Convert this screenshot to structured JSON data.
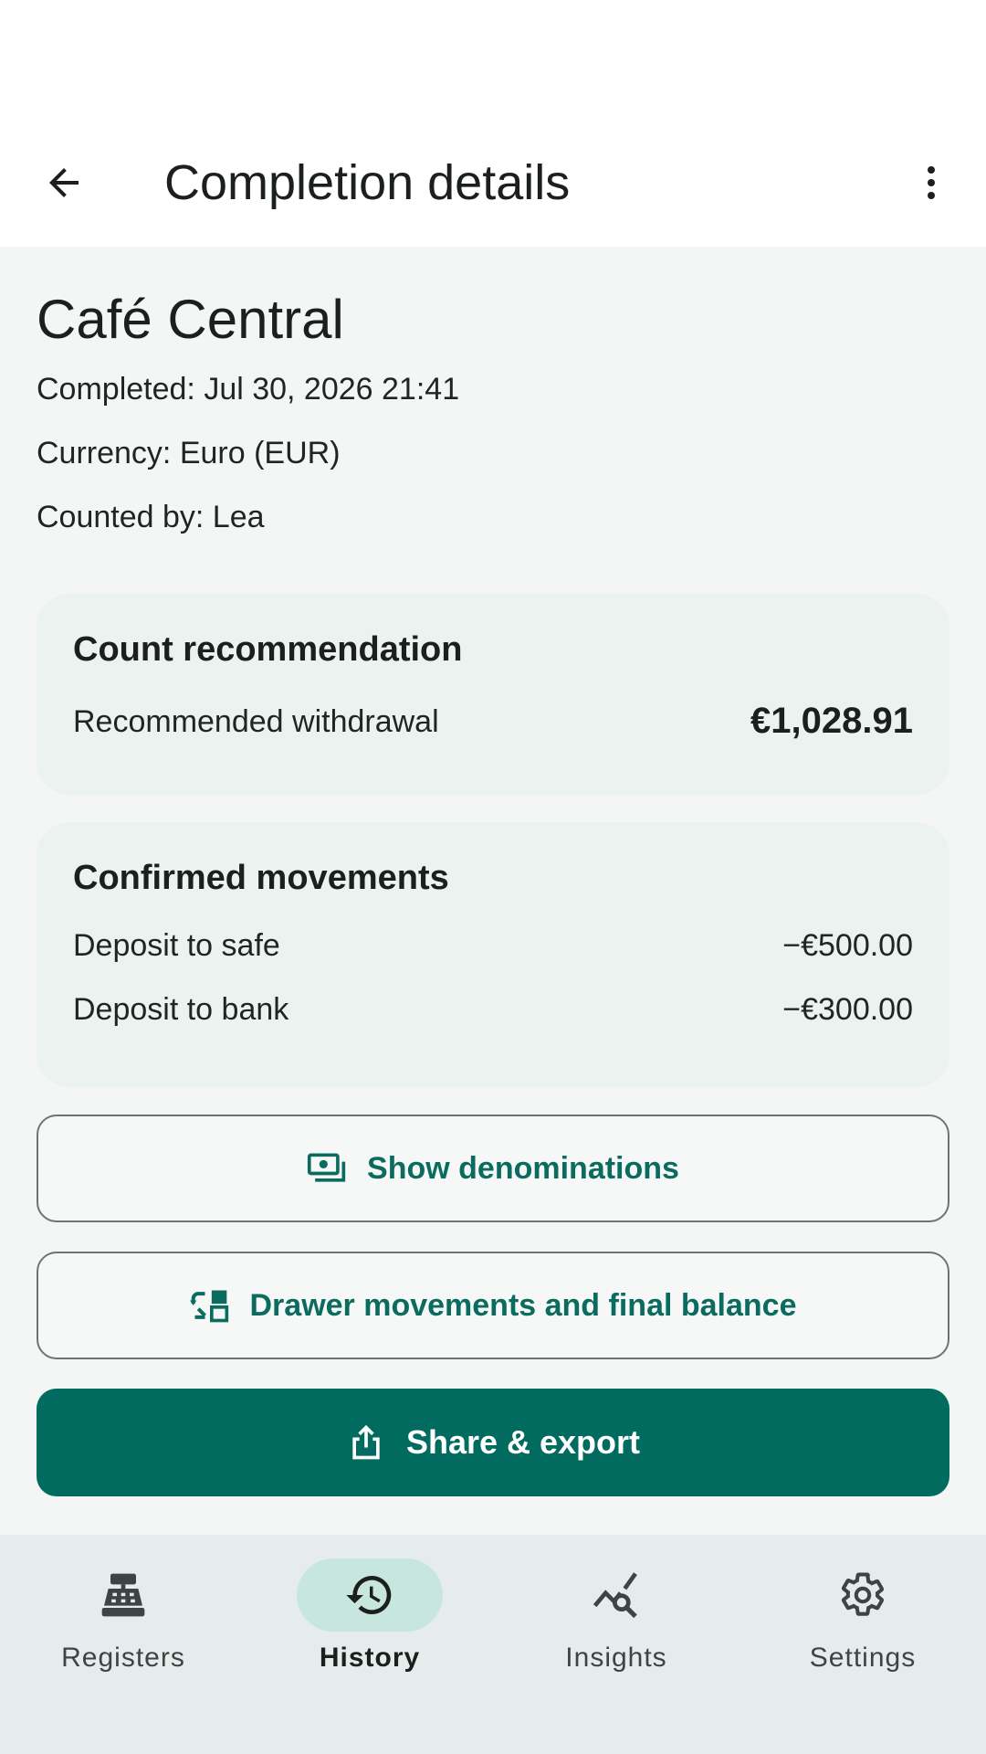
{
  "app_bar": {
    "title": "Completion details"
  },
  "register": {
    "name": "Café Central",
    "completed": "Completed: Jul 30, 2026 21:41",
    "currency": "Currency: Euro (EUR)",
    "counted_by": "Counted by: Lea"
  },
  "recommendation": {
    "title": "Count recommendation",
    "label": "Recommended withdrawal",
    "value": "€1,028.91"
  },
  "movements": {
    "title": "Confirmed movements",
    "items": [
      {
        "label": "Deposit to safe",
        "value": "−€500.00"
      },
      {
        "label": "Deposit to bank",
        "value": "−€300.00"
      }
    ]
  },
  "actions": {
    "show_denominations": "Show denominations",
    "drawer_movements": "Drawer movements and final balance",
    "share_export": "Share & export"
  },
  "bottom_nav": {
    "items": [
      {
        "label": "Registers",
        "icon": "cash-register-icon",
        "active": false
      },
      {
        "label": "History",
        "icon": "history-icon",
        "active": true
      },
      {
        "label": "Insights",
        "icon": "insights-icon",
        "active": false
      },
      {
        "label": "Settings",
        "icon": "gear-icon",
        "active": false
      }
    ]
  },
  "colors": {
    "primary": "#006b5e",
    "accent_text": "#0c6b5f",
    "active_pill": "#c7e6dd",
    "card_bg": "#ecf2f0",
    "content_bg": "#f3f6f5",
    "nav_bg": "#e6eceb"
  }
}
